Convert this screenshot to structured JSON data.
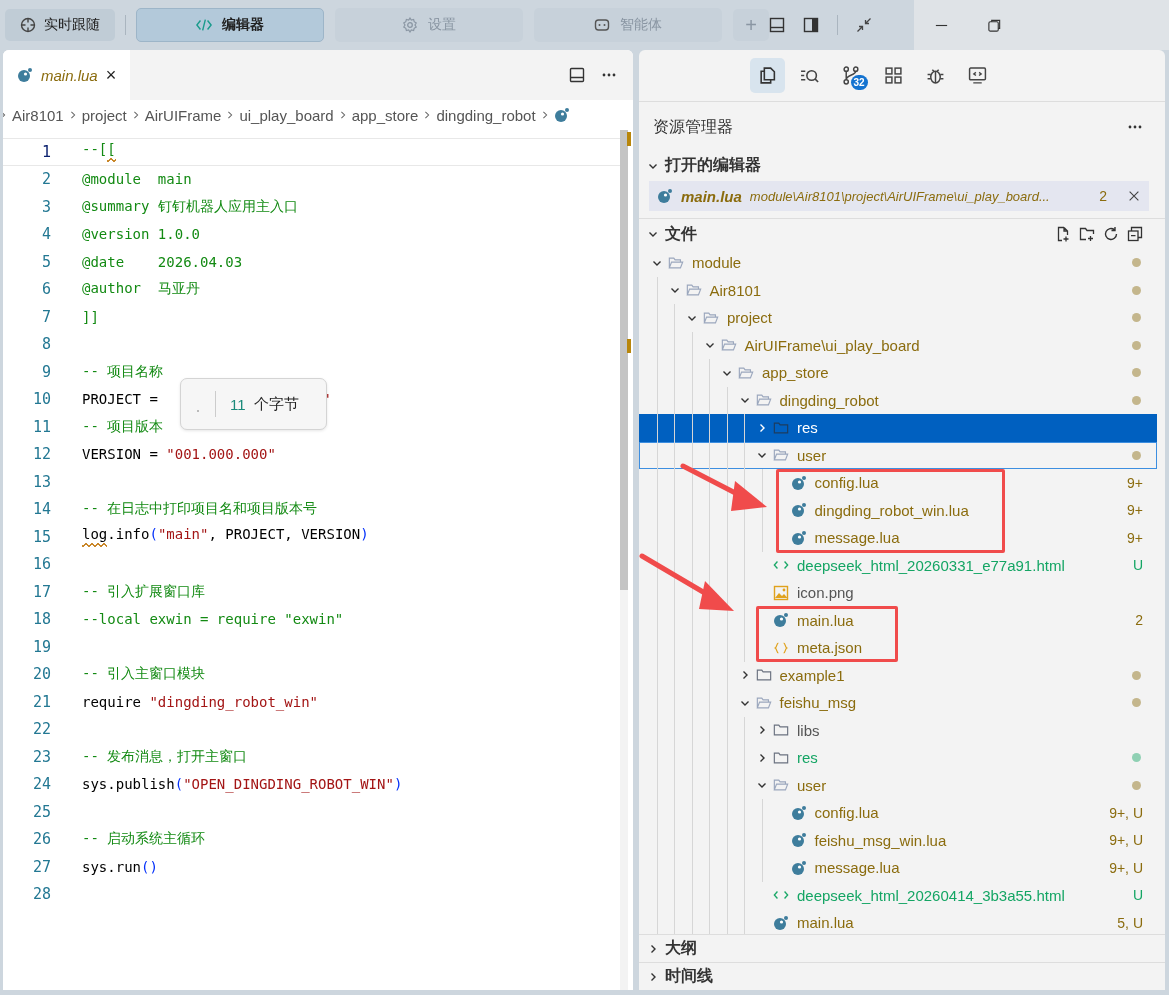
{
  "toolbar": {
    "follow_button": "实时跟随",
    "tabs": [
      {
        "label": "编辑器",
        "kind": "code",
        "selected": true
      },
      {
        "label": "设置",
        "kind": "gear",
        "selected": false
      },
      {
        "label": "智能体",
        "kind": "bot",
        "selected": false
      }
    ],
    "add_button": "+"
  },
  "editor": {
    "tab": {
      "label": "main.lua",
      "close": "×"
    },
    "breadcrumb": [
      "Air8101",
      "project",
      "AirUIFrame",
      "ui_play_board",
      "app_store",
      "dingding_robot"
    ],
    "lines": [
      {
        "number": "1",
        "current": true,
        "tokens": [
          {
            "kind": "comment",
            "text": "--[",
            "warning": false
          },
          {
            "kind": "comment",
            "text": "[",
            "warning": true
          }
        ]
      },
      {
        "number": "2",
        "current": false,
        "tokens": [
          {
            "kind": "comment",
            "text": "@module  main",
            "warning": false
          }
        ]
      },
      {
        "number": "3",
        "current": false,
        "tokens": [
          {
            "kind": "comment",
            "text": "@summary 钉钉机器人应用主入口",
            "warning": false
          }
        ]
      },
      {
        "number": "4",
        "current": false,
        "tokens": [
          {
            "kind": "comment",
            "text": "@version 1.0.0",
            "warning": false
          }
        ]
      },
      {
        "number": "5",
        "current": false,
        "tokens": [
          {
            "kind": "comment",
            "text": "@date    2026.04.03",
            "warning": false
          }
        ]
      },
      {
        "number": "6",
        "current": false,
        "tokens": [
          {
            "kind": "comment",
            "text": "@author  马亚丹",
            "warning": false
          }
        ]
      },
      {
        "number": "7",
        "current": false,
        "tokens": [
          {
            "kind": "comment",
            "text": "]]",
            "warning": false
          }
        ]
      },
      {
        "number": "8",
        "current": false
      },
      {
        "number": "9",
        "current": false,
        "tokens": [
          {
            "kind": "comment",
            "text": "-- 项目名称",
            "warning": false
          }
        ]
      },
      {
        "number": "10",
        "current": false,
        "tokens": [
          {
            "kind": "plain",
            "text": "PROJECT = ",
            "warning": false
          },
          {
            "kind": "gap",
            "warning": false
          },
          {
            "kind": "string",
            "text": "\"",
            "warning": false
          }
        ]
      },
      {
        "number": "11",
        "current": false,
        "tokens": [
          {
            "kind": "comment",
            "text": "-- 项目版本",
            "warning": false
          }
        ]
      },
      {
        "number": "12",
        "current": false,
        "tokens": [
          {
            "kind": "plain",
            "text": "VERSION = ",
            "warning": false
          },
          {
            "kind": "string",
            "text": "\"001.000.000\"",
            "warning": false
          }
        ]
      },
      {
        "number": "13",
        "current": false
      },
      {
        "number": "14",
        "current": false,
        "tokens": [
          {
            "kind": "comment",
            "text": "-- 在日志中打印项目名和项目版本号",
            "warning": false
          }
        ]
      },
      {
        "number": "15",
        "current": false,
        "tokens": [
          {
            "kind": "plain",
            "text": "log",
            "warning": true
          },
          {
            "kind": "plain",
            "text": ".info",
            "warning": false
          },
          {
            "kind": "paren",
            "text": "(",
            "warning": false
          },
          {
            "kind": "string",
            "text": "\"main\"",
            "warning": false
          },
          {
            "kind": "plain",
            "text": ", PROJECT, VERSION",
            "warning": false
          },
          {
            "kind": "paren",
            "text": ")",
            "warning": false
          }
        ]
      },
      {
        "number": "16",
        "current": false
      },
      {
        "number": "17",
        "current": false,
        "tokens": [
          {
            "kind": "comment",
            "text": "-- 引入扩展窗口库",
            "warning": false
          }
        ]
      },
      {
        "number": "18",
        "current": false,
        "tokens": [
          {
            "kind": "comment",
            "text": "--local exwin = require \"exwin\"",
            "warning": false
          }
        ]
      },
      {
        "number": "19",
        "current": false
      },
      {
        "number": "20",
        "current": false,
        "tokens": [
          {
            "kind": "comment",
            "text": "-- 引入主窗口模块",
            "warning": false
          }
        ]
      },
      {
        "number": "21",
        "current": false,
        "tokens": [
          {
            "kind": "plain",
            "text": "require ",
            "warning": false
          },
          {
            "kind": "string",
            "text": "\"dingding_robot_win\"",
            "warning": false
          }
        ]
      },
      {
        "number": "22",
        "current": false
      },
      {
        "number": "23",
        "current": false,
        "tokens": [
          {
            "kind": "comment",
            "text": "-- 发布消息，打开主窗口",
            "warning": false
          }
        ]
      },
      {
        "number": "24",
        "current": false,
        "tokens": [
          {
            "kind": "plain",
            "text": "sys.publish",
            "warning": false
          },
          {
            "kind": "paren",
            "text": "(",
            "warning": false
          },
          {
            "kind": "string",
            "text": "\"OPEN_DINGDING_ROBOT_WIN\"",
            "warning": false
          },
          {
            "kind": "paren",
            "text": ")",
            "warning": false
          }
        ]
      },
      {
        "number": "25",
        "current": false
      },
      {
        "number": "26",
        "current": false,
        "tokens": [
          {
            "kind": "comment",
            "text": "-- 启动系统主循环",
            "warning": false
          }
        ]
      },
      {
        "number": "27",
        "current": false,
        "tokens": [
          {
            "kind": "plain",
            "text": "sys.run",
            "warning": false
          },
          {
            "kind": "paren",
            "text": "()",
            "warning": false
          }
        ]
      },
      {
        "number": "28",
        "current": false
      }
    ],
    "tooltip": {
      "count": "11",
      "unit": "个字节"
    }
  },
  "explorer": {
    "activity": [
      {
        "kind": "files",
        "selected": true
      },
      {
        "kind": "search",
        "selected": false
      },
      {
        "kind": "source-control",
        "selected": false,
        "badge": "32"
      },
      {
        "kind": "extensions",
        "selected": false
      },
      {
        "kind": "debug",
        "selected": false
      },
      {
        "kind": "remote",
        "selected": false
      }
    ],
    "title": "资源管理器",
    "open_editors": {
      "label": "打开的编辑器",
      "expanded": true,
      "items": [
        {
          "name": "main.lua",
          "path": "module\\Air8101\\project\\AirUIFrame\\ui_play_board...",
          "badge": "2"
        }
      ]
    },
    "files": {
      "label": "文件",
      "expanded": true,
      "tree": [
        {
          "name": "module",
          "kind": "folder",
          "color": "#8b6c0e",
          "dot": true,
          "expanded": true,
          "selected": false,
          "focused": false,
          "children": [
            {
              "name": "Air8101",
              "kind": "folder",
              "color": "#8b6c0e",
              "dot": true,
              "expanded": true,
              "selected": false,
              "focused": false,
              "children": [
                {
                  "name": "project",
                  "kind": "folder",
                  "color": "#8b6c0e",
                  "dot": true,
                  "expanded": true,
                  "selected": false,
                  "focused": false,
                  "children": [
                    {
                      "name": "AirUIFrame\\ui_play_board",
                      "kind": "folder",
                      "color": "#8b6c0e",
                      "dot": true,
                      "expanded": true,
                      "selected": false,
                      "focused": false,
                      "children": [
                        {
                          "name": "app_store",
                          "kind": "folder",
                          "color": "#8b6c0e",
                          "dot": true,
                          "expanded": true,
                          "selected": false,
                          "focused": false,
                          "children": [
                            {
                              "name": "dingding_robot",
                              "kind": "folder",
                              "color": "#8b6c0e",
                              "dot": true,
                              "expanded": true,
                              "selected": false,
                              "focused": false,
                              "children": [
                                {
                                  "name": "res",
                                  "kind": "folder",
                                  "color": "#ffffff",
                                  "dot": false,
                                  "expanded": false,
                                  "selected": true,
                                  "focused": false
                                },
                                {
                                  "name": "user",
                                  "kind": "folder",
                                  "color": "#8b6c0e",
                                  "dot": true,
                                  "expanded": true,
                                  "selected": false,
                                  "focused": true,
                                  "children": [
                                    {
                                      "name": "config.lua",
                                      "kind": "lua",
                                      "color": "#8b6c0e",
                                      "selected": false,
                                      "focused": false,
                                      "badge": "9+"
                                    },
                                    {
                                      "name": "dingding_robot_win.lua",
                                      "kind": "lua",
                                      "color": "#8b6c0e",
                                      "selected": false,
                                      "focused": false,
                                      "badge": "9+"
                                    },
                                    {
                                      "name": "message.lua",
                                      "kind": "lua",
                                      "color": "#8b6c0e",
                                      "selected": false,
                                      "focused": false,
                                      "badge": "9+"
                                    }
                                  ]
                                },
                                {
                                  "name": "deepseek_html_20260331_e77a91.html",
                                  "kind": "html",
                                  "color": "#14a564",
                                  "selected": false,
                                  "focused": false,
                                  "badge": "U"
                                },
                                {
                                  "name": "icon.png",
                                  "kind": "image",
                                  "color": "#555555",
                                  "selected": false,
                                  "focused": false
                                },
                                {
                                  "name": "main.lua",
                                  "kind": "lua",
                                  "color": "#8b6c0e",
                                  "selected": false,
                                  "focused": false,
                                  "badge": "2"
                                },
                                {
                                  "name": "meta.json",
                                  "kind": "json",
                                  "color": "#8b6c0e",
                                  "selected": false,
                                  "focused": false
                                }
                              ]
                            },
                            {
                              "name": "example1",
                              "kind": "folder",
                              "color": "#8b6c0e",
                              "dot": true,
                              "expanded": false,
                              "selected": false,
                              "focused": false
                            },
                            {
                              "name": "feishu_msg",
                              "kind": "folder",
                              "color": "#8b6c0e",
                              "dot": true,
                              "expanded": true,
                              "selected": false,
                              "focused": false,
                              "children": [
                                {
                                  "name": "libs",
                                  "kind": "folder",
                                  "color": "#555555",
                                  "dot": false,
                                  "expanded": false,
                                  "selected": false,
                                  "focused": false
                                },
                                {
                                  "name": "res",
                                  "kind": "folder",
                                  "color": "#14a564",
                                  "dot": true,
                                  "expanded": false,
                                  "selected": false,
                                  "focused": false
                                },
                                {
                                  "name": "user",
                                  "kind": "folder",
                                  "color": "#8b6c0e",
                                  "dot": true,
                                  "expanded": true,
                                  "selected": false,
                                  "focused": false,
                                  "children": [
                                    {
                                      "name": "config.lua",
                                      "kind": "lua",
                                      "color": "#8b6c0e",
                                      "selected": false,
                                      "focused": false,
                                      "badge": "9+, U"
                                    },
                                    {
                                      "name": "feishu_msg_win.lua",
                                      "kind": "lua",
                                      "color": "#8b6c0e",
                                      "selected": false,
                                      "focused": false,
                                      "badge": "9+, U"
                                    },
                                    {
                                      "name": "message.lua",
                                      "kind": "lua",
                                      "color": "#8b6c0e",
                                      "selected": false,
                                      "focused": false,
                                      "badge": "9+, U"
                                    }
                                  ]
                                },
                                {
                                  "name": "deepseek_html_20260414_3b3a55.html",
                                  "kind": "html",
                                  "color": "#14a564",
                                  "selected": false,
                                  "focused": false,
                                  "badge": "U"
                                },
                                {
                                  "name": "main.lua",
                                  "kind": "lua",
                                  "color": "#8b6c0e",
                                  "selected": false,
                                  "focused": false,
                                  "badge": "5, U"
                                }
                              ]
                            }
                          ]
                        }
                      ]
                    }
                  ]
                }
              ]
            }
          ]
        }
      ]
    },
    "sections": [
      {
        "label": "大纲",
        "expanded": false
      },
      {
        "label": "时间线",
        "expanded": false
      }
    ]
  }
}
